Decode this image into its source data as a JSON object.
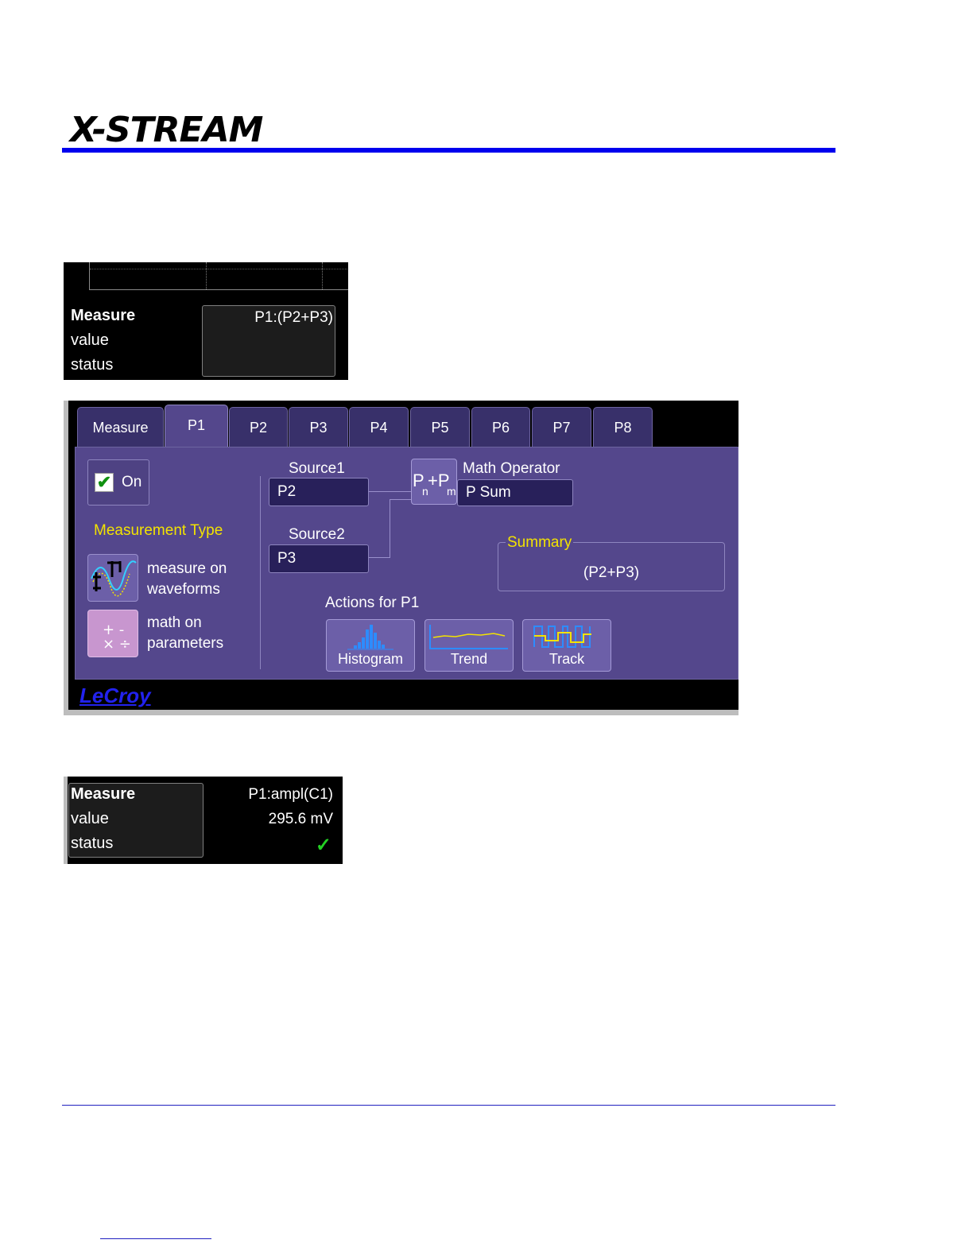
{
  "header": {
    "logo_text": "X-STREAM",
    "rule_color": "#0000ee"
  },
  "measure_table_top": {
    "row_measure": "Measure",
    "row_value": "value",
    "row_status": "status",
    "p1_header": "P1:(P2+P3)"
  },
  "dialog": {
    "tabs": [
      {
        "label": "Measure",
        "active": false
      },
      {
        "label": "P1",
        "active": true
      },
      {
        "label": "P2",
        "active": false
      },
      {
        "label": "P3",
        "active": false
      },
      {
        "label": "P4",
        "active": false
      },
      {
        "label": "P5",
        "active": false
      },
      {
        "label": "P6",
        "active": false
      },
      {
        "label": "P7",
        "active": false
      },
      {
        "label": "P8",
        "active": false
      }
    ],
    "on_label": "On",
    "on_checked": true,
    "measurement_type_title": "Measurement Type",
    "type_waveforms_line1": "measure on",
    "type_waveforms_line2": "waveforms",
    "type_params_line1": "math on",
    "type_params_line2": "parameters",
    "source1_label": "Source1",
    "source1_value": "P2",
    "source2_label": "Source2",
    "source2_value": "P3",
    "math_operator_label": "Math Operator",
    "math_operator_value": "P Sum",
    "operator_icon_main": "P",
    "operator_icon_sub_n": "n",
    "operator_icon_plus": "+P",
    "operator_icon_sub_m": "m",
    "summary_title": "Summary",
    "summary_value": "(P2+P3)",
    "actions_title": "Actions for P1",
    "action_histogram": "Histogram",
    "action_trend": "Trend",
    "action_track": "Track",
    "brand": "LeCroy",
    "accent_yellow": "#f3e300",
    "panel_purple": "#54478c"
  },
  "measure_table_bottom": {
    "row_measure": "Measure",
    "row_value": "value",
    "row_status": "status",
    "p1_header": "P1:ampl(C1)",
    "p1_value": "295.6 mV",
    "p1_status_icon": "check-icon"
  }
}
